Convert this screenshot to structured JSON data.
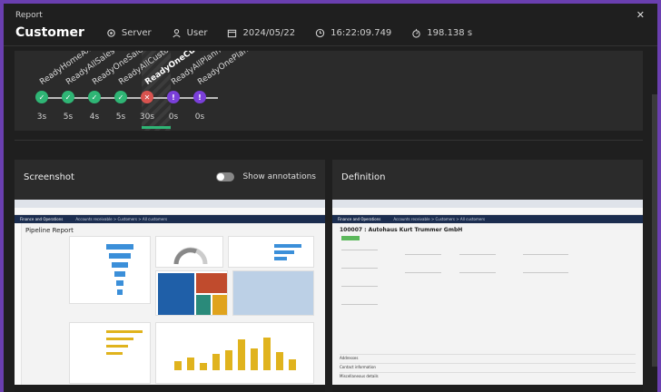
{
  "header": {
    "label": "Report",
    "close_icon": "close-icon",
    "title": "Customer",
    "items": [
      {
        "icon": "server-icon",
        "text": "Server"
      },
      {
        "icon": "user-icon",
        "text": "User"
      },
      {
        "icon": "calendar-icon",
        "text": "2024/05/22"
      },
      {
        "icon": "clock-icon",
        "text": "16:22:09.749"
      },
      {
        "icon": "stopwatch-icon",
        "text": "198.138 s"
      }
    ]
  },
  "timeline": {
    "steps": [
      {
        "label": "ReadyHomeAx",
        "status": "passed",
        "duration": "3s"
      },
      {
        "label": "ReadyAllSalesO...",
        "status": "passed",
        "duration": "5s"
      },
      {
        "label": "ReadyOneSales...",
        "status": "passed",
        "duration": "4s"
      },
      {
        "label": "ReadyAllCustom...",
        "status": "passed",
        "duration": "5s"
      },
      {
        "label": "ReadyOneCusto...",
        "status": "failed",
        "duration": "30s"
      },
      {
        "label": "ReadyAllPlanne...",
        "status": "pending",
        "duration": "0s"
      },
      {
        "label": "ReadyOnePlann...",
        "status": "pending",
        "duration": "0s"
      }
    ],
    "colors": {
      "passed": "#2fb575",
      "failed": "#d9534f",
      "pending": "#7a3fd9"
    }
  },
  "screenshot": {
    "title": "Screenshot",
    "toggle_label": "Show annotations",
    "app_name": "Finance and Operations",
    "breadcrumb": "Accounts receivable > Customers > All customers",
    "report_title": "Pipeline Report"
  },
  "definition": {
    "title": "Definition",
    "app_name": "Finance and Operations",
    "breadcrumb": "Accounts receivable > Customers > All customers",
    "record_title": "100007 : Autohaus Kurt Trummer GmbH",
    "sections": [
      "Addresses",
      "Contact information",
      "Miscellaneous details"
    ]
  }
}
